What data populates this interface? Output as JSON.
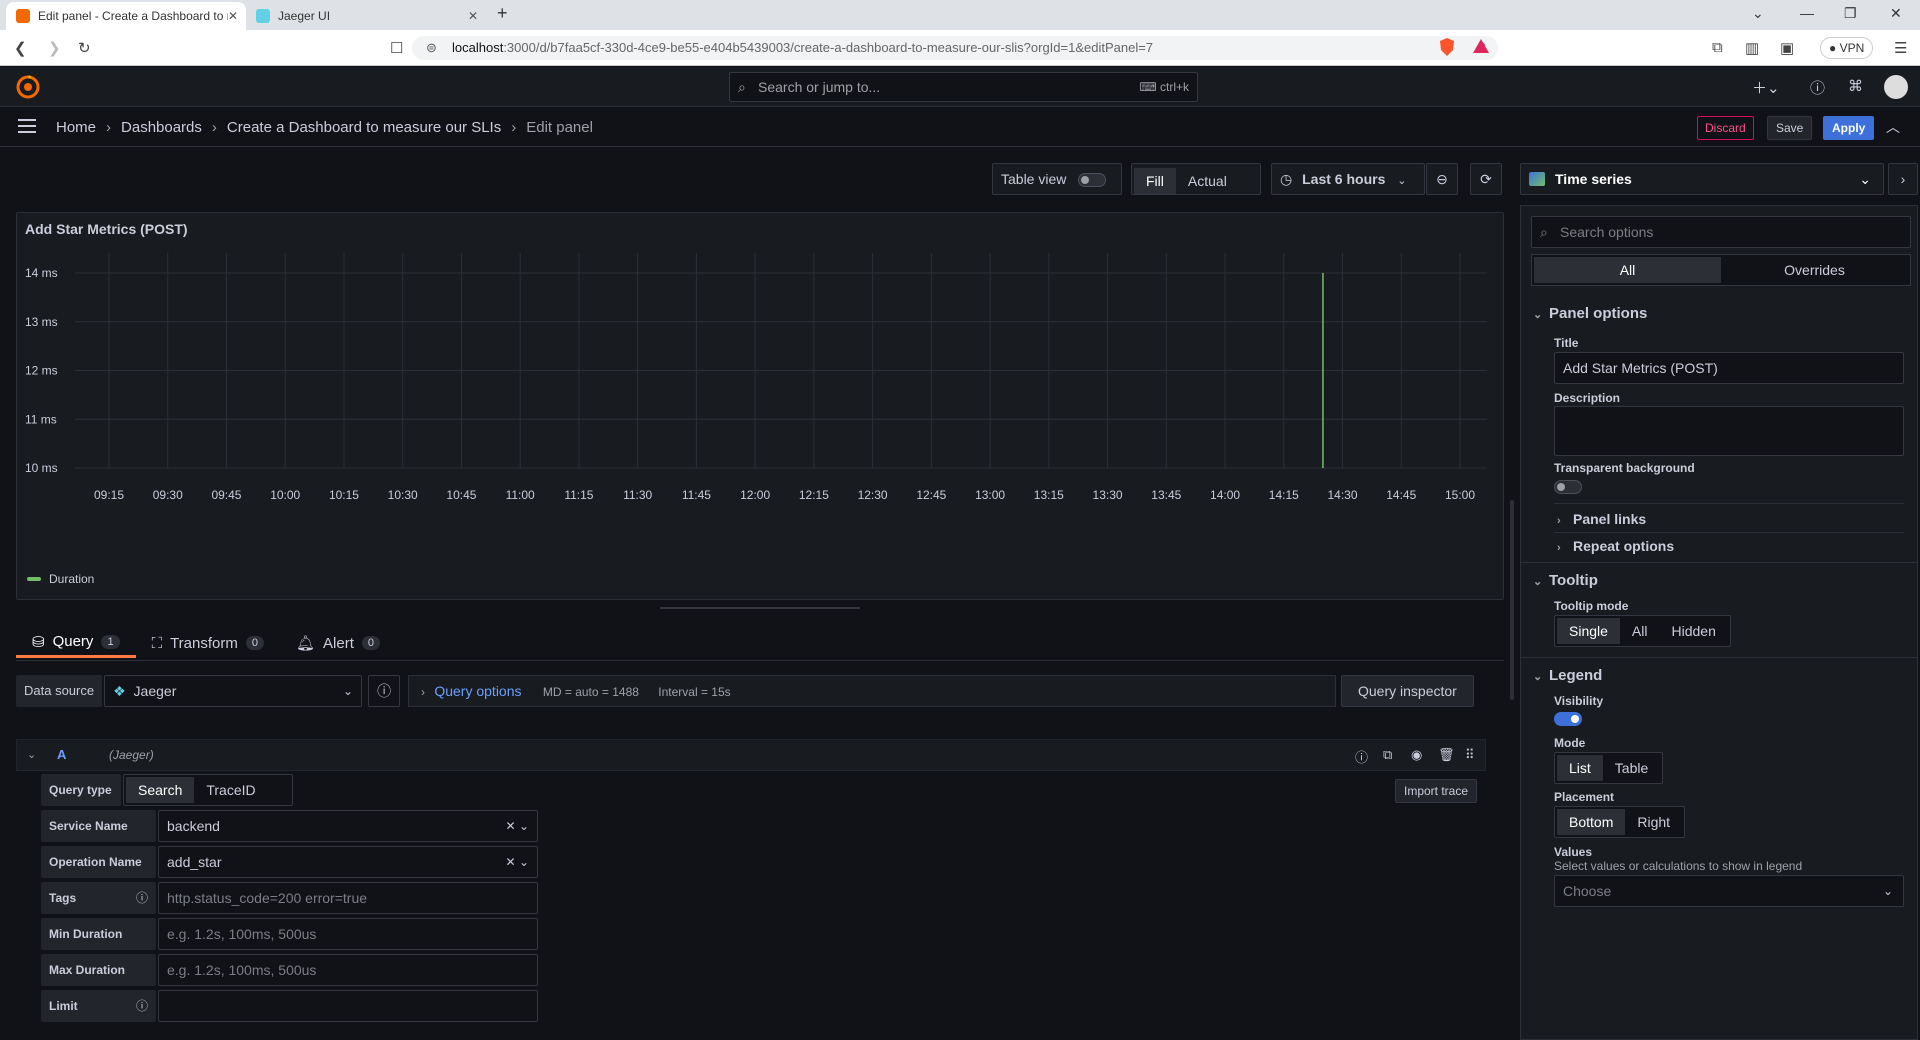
{
  "browser": {
    "tabs": [
      {
        "title": "Edit panel - Create a Dashboard to me"
      },
      {
        "title": "Jaeger UI"
      }
    ],
    "url_host": "localhost",
    "url_path": ":3000/d/b7faa5cf-330d-4ce9-be55-e404b5439003/create-a-dashboard-to-measure-our-slis?orgId=1&editPanel=7",
    "vpn_label": "VPN"
  },
  "topnav": {
    "search_placeholder": "Search or jump to...",
    "shortcut": "ctrl+k"
  },
  "breadcrumb": {
    "home": "Home",
    "dashboards": "Dashboards",
    "dashboard": "Create a Dashboard to measure our SLIs",
    "current": "Edit panel"
  },
  "actions": {
    "discard": "Discard",
    "save": "Save",
    "apply": "Apply"
  },
  "panel_toolbar": {
    "table_view": "Table view",
    "fill": "Fill",
    "actual": "Actual",
    "time_range": "Last 6 hours"
  },
  "panel": {
    "title": "Add Star Metrics (POST)",
    "legend": "Duration"
  },
  "chart_data": {
    "type": "line",
    "title": "Add Star Metrics (POST)",
    "x_ticks": [
      "09:15",
      "09:30",
      "09:45",
      "10:00",
      "10:15",
      "10:30",
      "10:45",
      "11:00",
      "11:15",
      "11:30",
      "11:45",
      "12:00",
      "12:15",
      "12:30",
      "12:45",
      "13:00",
      "13:15",
      "13:30",
      "13:45",
      "14:00",
      "14:15",
      "14:30",
      "14:45",
      "15:00"
    ],
    "y_ticks": [
      "14 ms",
      "13 ms",
      "12 ms",
      "11 ms",
      "10 ms"
    ],
    "ylim": [
      10,
      14
    ],
    "series": [
      {
        "name": "Duration",
        "color": "#73bf69",
        "points": [
          {
            "x": "14:25",
            "y": 10
          },
          {
            "x": "14:25",
            "y": 14
          }
        ]
      }
    ],
    "grid": true,
    "legend_position": "bottom-left"
  },
  "query_tabs": [
    {
      "label": "Query",
      "count": "1"
    },
    {
      "label": "Transform",
      "count": "0"
    },
    {
      "label": "Alert",
      "count": "0"
    }
  ],
  "datasource": {
    "label": "Data source",
    "value": "Jaeger",
    "query_options": "Query options",
    "md": "MD = auto = 1488",
    "interval": "Interval = 15s",
    "inspector": "Query inspector"
  },
  "query": {
    "ref": "A",
    "ds": "(Jaeger)",
    "query_type_label": "Query type",
    "type_search": "Search",
    "type_traceid": "TraceID",
    "import_trace": "Import trace",
    "service_label": "Service Name",
    "service_value": "backend",
    "operation_label": "Operation Name",
    "operation_value": "add_star",
    "tags_label": "Tags",
    "tags_placeholder": "http.status_code=200 error=true",
    "min_label": "Min Duration",
    "min_placeholder": "e.g. 1.2s, 100ms, 500us",
    "max_label": "Max Duration",
    "max_placeholder": "e.g. 1.2s, 100ms, 500us",
    "limit_label": "Limit"
  },
  "options": {
    "viz": "Time series",
    "search_placeholder": "Search options",
    "tab_all": "All",
    "tab_overrides": "Overrides",
    "panel_options": "Panel options",
    "title_label": "Title",
    "title_value": "Add Star Metrics (POST)",
    "description_label": "Description",
    "transparent_label": "Transparent background",
    "panel_links": "Panel links",
    "repeat_options": "Repeat options",
    "tooltip": "Tooltip",
    "tooltip_mode": "Tooltip mode",
    "tooltip_single": "Single",
    "tooltip_all": "All",
    "tooltip_hidden": "Hidden",
    "legend": "Legend",
    "visibility": "Visibility",
    "mode": "Mode",
    "mode_list": "List",
    "mode_table": "Table",
    "placement": "Placement",
    "placement_bottom": "Bottom",
    "placement_right": "Right",
    "values": "Values",
    "values_desc": "Select values or calculations to show in legend",
    "values_placeholder": "Choose"
  }
}
